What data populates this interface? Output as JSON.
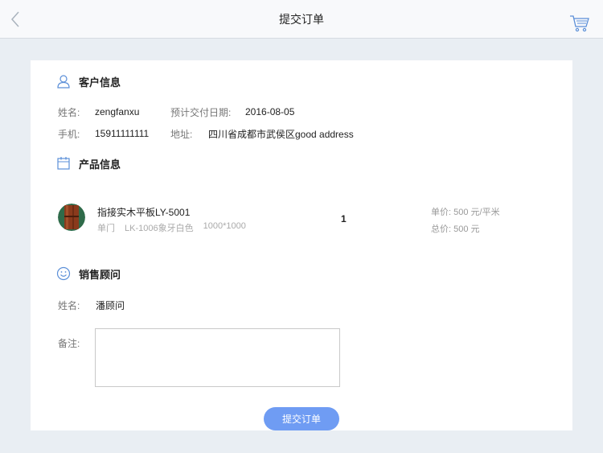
{
  "nav": {
    "title": "提交订单",
    "back_icon": "chevron-left-icon",
    "cart_icon": "cart-icon"
  },
  "customer": {
    "section_title": "客户信息",
    "name_label": "姓名:",
    "name_value": "zengfanxu",
    "date_label": "预计交付日期:",
    "date_value": "2016-08-05",
    "phone_label": "手机:",
    "phone_value": "15911111111",
    "address_label": "地址:",
    "address_value": "四川省成都市武侯区good address"
  },
  "product": {
    "section_title": "产品信息",
    "name": "指接实木平板LY-5001",
    "type": "单门",
    "model": "LK-1006象牙白色",
    "size": "1000*1000",
    "quantity": "1",
    "unit_price": "单价: 500 元/平米",
    "total_price": "总价: 500 元"
  },
  "advisor": {
    "section_title": "销售顾问",
    "name_label": "姓名:",
    "name_value": "潘顾问",
    "remark_label": "备注:",
    "remark_value": ""
  },
  "actions": {
    "submit_label": "提交订单"
  },
  "colors": {
    "accent": "#6f9cf3",
    "background": "#e9eef3",
    "icon_blue": "#5b8fd8"
  }
}
